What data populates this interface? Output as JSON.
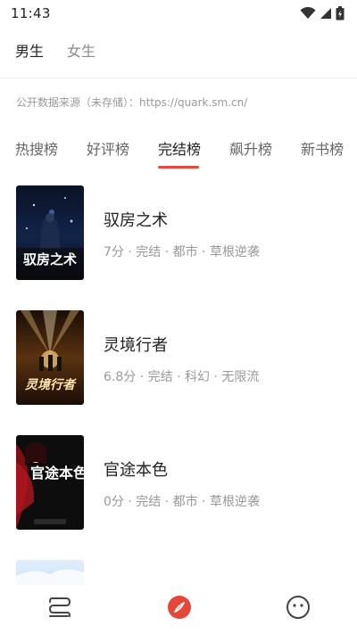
{
  "status_bar": {
    "time": "11:43"
  },
  "gender_tabs": [
    {
      "label": "男生",
      "active": true
    },
    {
      "label": "女生",
      "active": false
    }
  ],
  "source_note": "公开数据来源（未存储）：https://quark.sm.cn/",
  "rank_tabs": [
    {
      "label": "热搜榜",
      "active": false
    },
    {
      "label": "好评榜",
      "active": false
    },
    {
      "label": "完结榜",
      "active": true
    },
    {
      "label": "飙升榜",
      "active": false
    },
    {
      "label": "新书榜",
      "active": false
    }
  ],
  "books": [
    {
      "title": "驭房之术",
      "meta": "7分 · 完结 · 都市 · 草根逆袭",
      "cover_text": "驭房之术"
    },
    {
      "title": "灵境行者",
      "meta": "6.8分 · 完结 · 科幻 · 无限流",
      "cover_text": "灵境行者"
    },
    {
      "title": "官途本色",
      "meta": "0分 · 完结 · 都市 · 草根逆袭",
      "cover_text": "官途本色"
    },
    {
      "title": "",
      "meta": "",
      "cover_text": ""
    }
  ],
  "colors": {
    "accent": "#e5483a",
    "text_primary": "#222222",
    "text_secondary": "#999999"
  },
  "bottom_nav": [
    {
      "icon": "shelf-icon",
      "active": false
    },
    {
      "icon": "compass-icon",
      "active": true
    },
    {
      "icon": "smiley-icon",
      "active": false
    }
  ]
}
